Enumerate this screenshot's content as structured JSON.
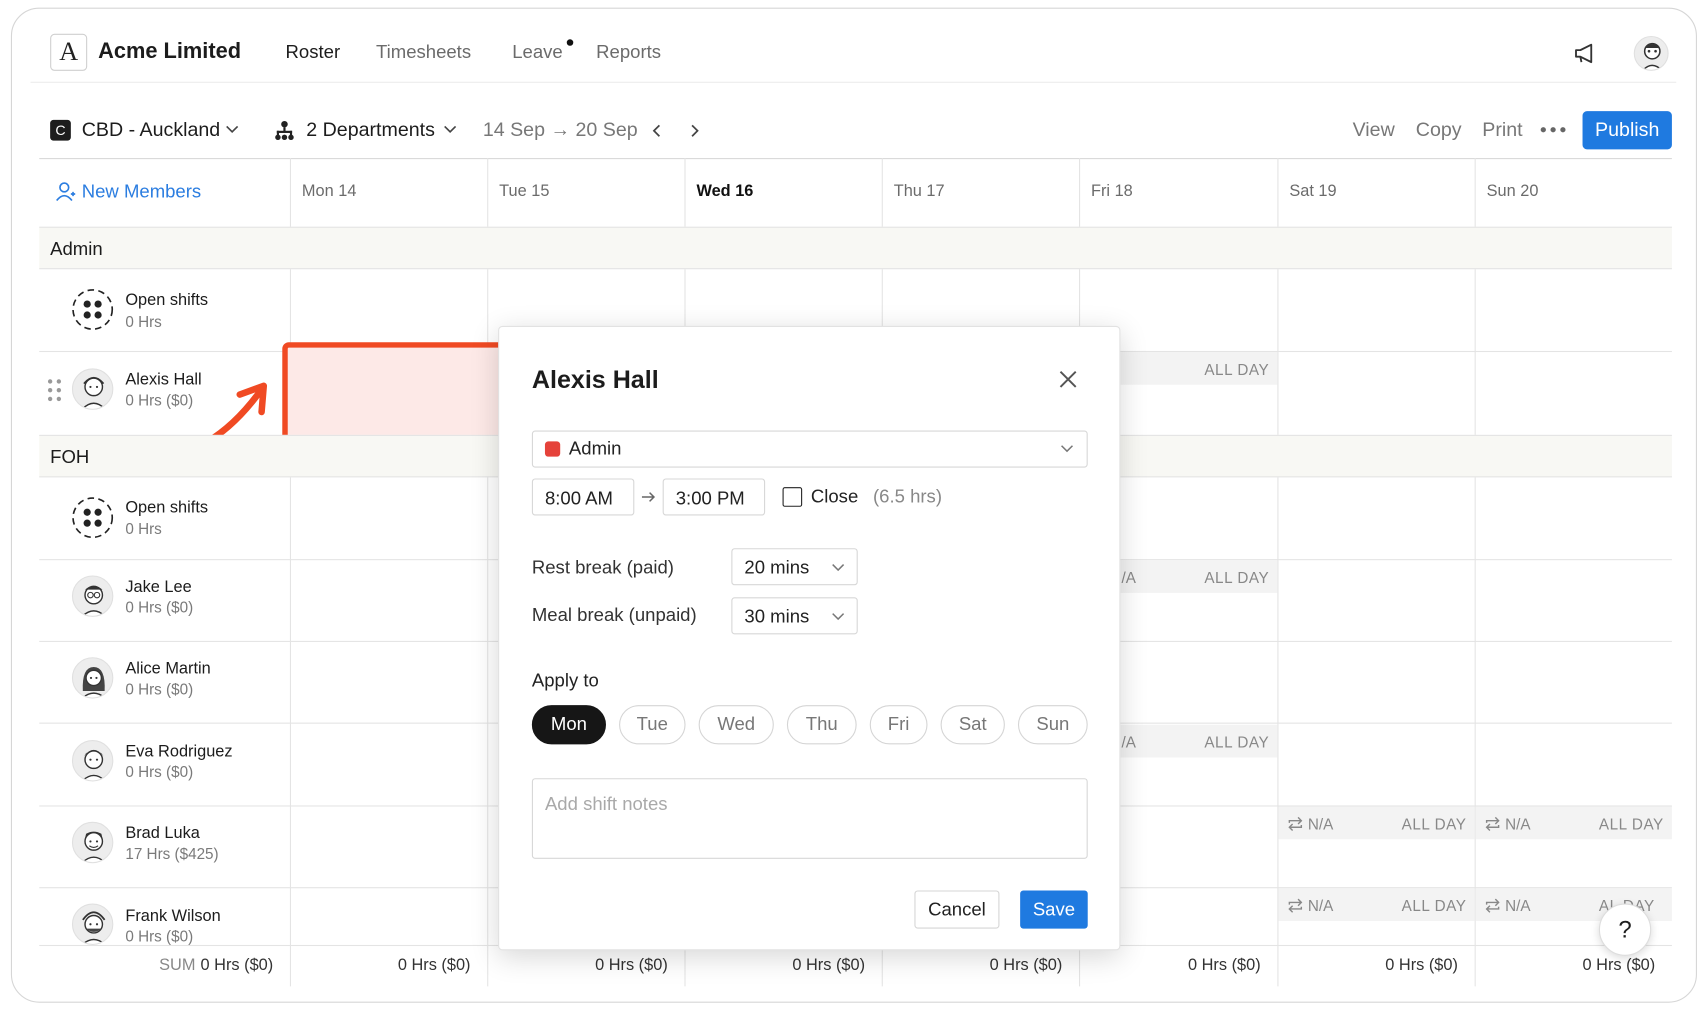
{
  "app": {
    "company": "Acme Limited",
    "logo_letter": "A",
    "nav": [
      "Roster",
      "Timesheets",
      "Leave",
      "Reports"
    ]
  },
  "toolbar": {
    "location_badge": "C",
    "location": "CBD - Auckland",
    "departments": "2 Departments",
    "date_range": "14 Sep → 20 Sep",
    "actions": [
      "View",
      "Copy",
      "Print"
    ],
    "publish": "Publish"
  },
  "grid": {
    "new_members": "New Members",
    "days": [
      "Mon 14",
      "Tue 15",
      "Wed 16",
      "Thu 17",
      "Fri 18",
      "Sat 19",
      "Sun 20"
    ],
    "sections": [
      {
        "name": "Admin",
        "rows": [
          {
            "name": "Open shifts",
            "hours": "0 Hrs"
          },
          {
            "name": "Alexis Hall",
            "hours": "0 Hrs ($0)"
          }
        ]
      },
      {
        "name": "FOH",
        "rows": [
          {
            "name": "Open shifts",
            "hours": "0 Hrs"
          },
          {
            "name": "Jake Lee",
            "hours": "0 Hrs ($0)"
          },
          {
            "name": "Alice Martin",
            "hours": "0 Hrs ($0)"
          },
          {
            "name": "Eva Rodriguez",
            "hours": "0 Hrs ($0)"
          },
          {
            "name": "Brad Luka",
            "hours": "17 Hrs ($425)"
          },
          {
            "name": "Frank Wilson",
            "hours": "0 Hrs ($0)"
          }
        ]
      }
    ],
    "availability": {
      "all_day": "ALL DAY",
      "na": "N/A",
      "na_partial": "/A",
      "all_day_partial": "AL  DAY"
    },
    "footer": {
      "sum_label": "SUM",
      "totals": [
        "0 Hrs ($0)",
        "0 Hrs ($0)",
        "0 Hrs ($0)",
        "0 Hrs ($0)",
        "0 Hrs ($0)",
        "0 Hrs ($0)",
        "0 Hrs ($0)",
        "0 Hrs ($0)"
      ]
    }
  },
  "modal": {
    "title": "Alexis Hall",
    "role": "Admin",
    "role_color": "#e5423a",
    "start_time": "8:00 AM",
    "end_time": "3:00 PM",
    "close_label": "Close",
    "duration": "(6.5 hrs)",
    "rest_break_label": "Rest break (paid)",
    "rest_break_value": "20 mins",
    "meal_break_label": "Meal break (unpaid)",
    "meal_break_value": "30 mins",
    "apply_to_label": "Apply to",
    "apply_days": [
      "Mon",
      "Tue",
      "Wed",
      "Thu",
      "Fri",
      "Sat",
      "Sun"
    ],
    "apply_selected": "Mon",
    "notes_placeholder": "Add shift notes",
    "cancel": "Cancel",
    "save": "Save"
  },
  "help_label": "?",
  "colors": {
    "accent": "#1f7ae0",
    "highlight": "#f04a23",
    "section_bg": "#f8f8f4"
  }
}
